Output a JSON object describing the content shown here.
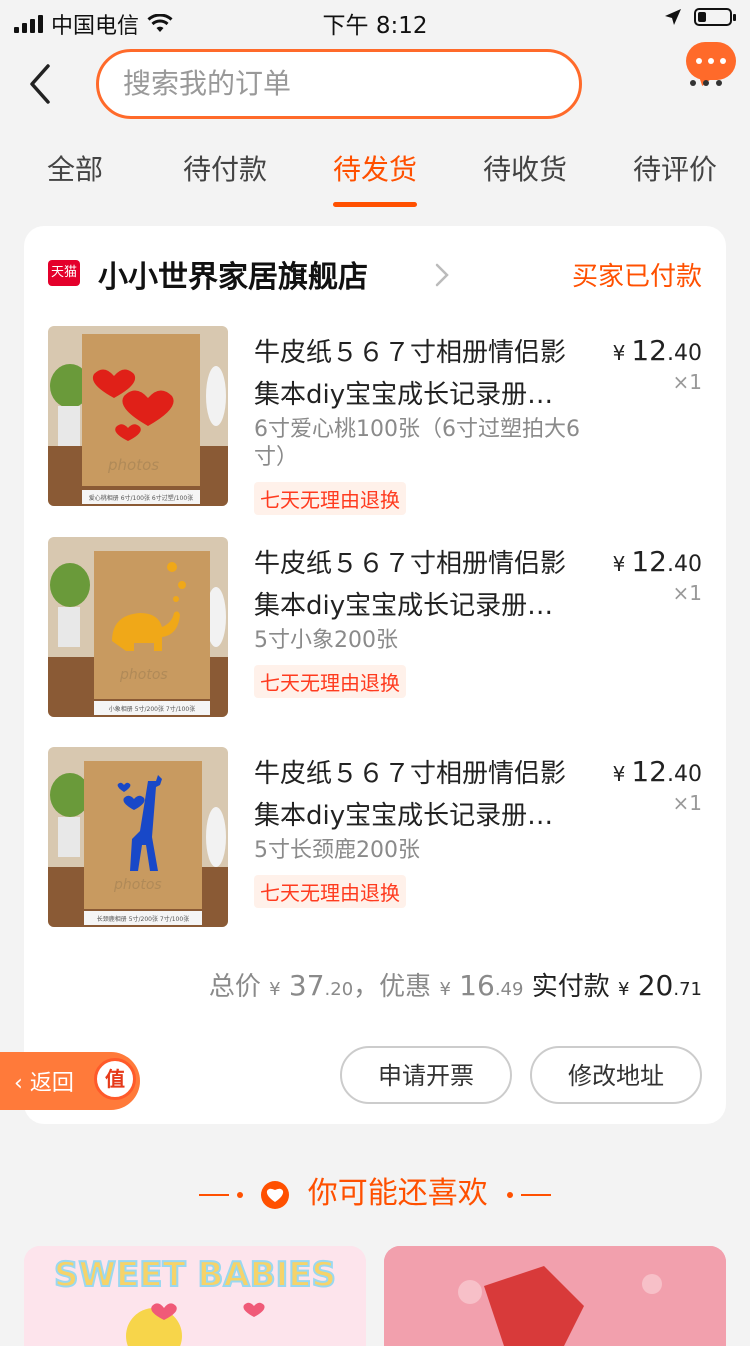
{
  "status_bar": {
    "carrier": "中国电信",
    "time": "下午 8:12"
  },
  "search": {
    "placeholder": "搜索我的订单"
  },
  "tabs": [
    {
      "label": "全部"
    },
    {
      "label": "待付款"
    },
    {
      "label": "待发货",
      "active": true
    },
    {
      "label": "待收货"
    },
    {
      "label": "待评价"
    }
  ],
  "order": {
    "shop_badge": "天猫",
    "shop_name": "小小世界家居旗舰店",
    "status": "买家已付款",
    "items": [
      {
        "title": "牛皮纸５６７寸相册情侣影集本diy宝宝成长记录册…",
        "sku": "6寸爱心桃100张（6寸过塑拍大6寸）",
        "tag": "七天无理由退换",
        "price_currency": "¥",
        "price_int": "12",
        "price_dec": ".40",
        "qty": "×1",
        "thumb_caption": "爱心桃相册  6寸/100张  6寸过塑/100张"
      },
      {
        "title": "牛皮纸５６７寸相册情侣影集本diy宝宝成长记录册…",
        "sku": "5寸小象200张",
        "tag": "七天无理由退换",
        "price_currency": "¥",
        "price_int": "12",
        "price_dec": ".40",
        "qty": "×1",
        "thumb_caption": "小象相册  5寸/200张  7寸/100张"
      },
      {
        "title": "牛皮纸５６７寸相册情侣影集本diy宝宝成长记录册…",
        "sku": "5寸长颈鹿200张",
        "tag": "七天无理由退换",
        "price_currency": "¥",
        "price_int": "12",
        "price_dec": ".40",
        "qty": "×1",
        "thumb_caption": "长颈鹿相册  5寸/200张  7寸/100张"
      }
    ],
    "summary": {
      "total_label": "总价",
      "total_currency": "¥",
      "total_int": "37",
      "total_dec": ".20",
      "discount_label": "，优惠",
      "discount_currency": "¥",
      "discount_int": "16",
      "discount_dec": ".49",
      "paid_label": "实付款",
      "paid_currency": "¥",
      "paid_int": "20",
      "paid_dec": ".71"
    },
    "buttons": {
      "invoice": "申请开票",
      "address": "修改地址"
    }
  },
  "float_back": {
    "label": "返回",
    "badge": "值"
  },
  "recommend": {
    "title": "你可能还喜欢",
    "banner_text": "SWEET BABIES"
  },
  "colors": {
    "accent": "#ff5000",
    "search_border": "#ff6a2a",
    "tmall_red": "#e4002b"
  }
}
